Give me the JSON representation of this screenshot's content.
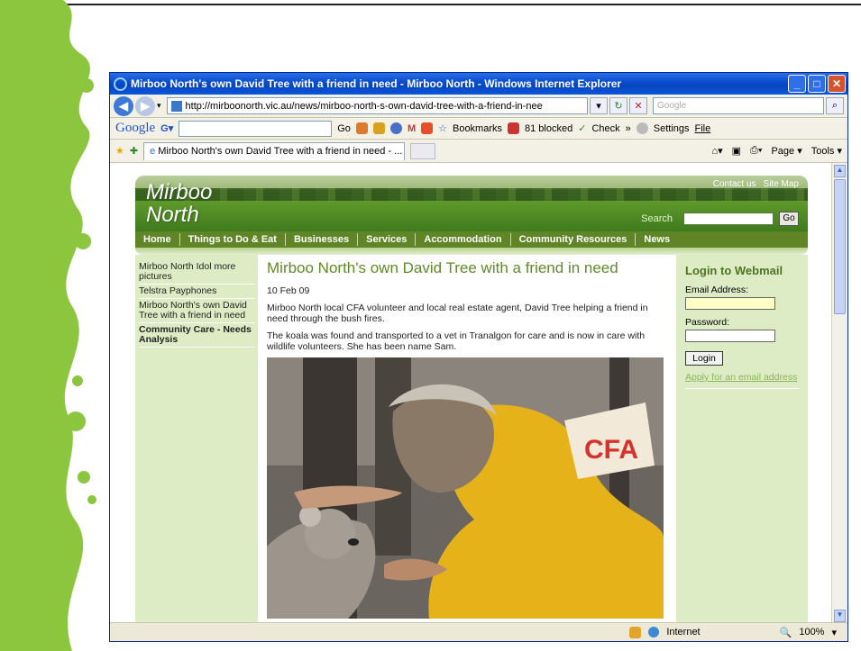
{
  "window": {
    "title": "Mirboo North's own David Tree with a friend in need - Mirboo North - Windows Internet Explorer",
    "url": "http://mirboonorth.vic.au/news/mirboo-north-s-own-david-tree-with-a-friend-in-nee",
    "search_placeholder": "Google"
  },
  "google_toolbar": {
    "logo": "Google",
    "go": "Go",
    "bookmarks": "Bookmarks",
    "blocked": "81 blocked",
    "check": "Check",
    "settings": "Settings",
    "file": "File"
  },
  "tabs": {
    "active": "Mirboo North's own David Tree with a friend in need - ...",
    "page": "Page",
    "tools": "Tools"
  },
  "site": {
    "name_line1": "Mirboo",
    "name_line2": "North",
    "contact": "Contact us",
    "sitemap": "Site Map",
    "search_label": "Search",
    "search_go": "Go",
    "nav": [
      "Home",
      "Things to Do & Eat",
      "Businesses",
      "Services",
      "Accommodation",
      "Community Resources",
      "News"
    ]
  },
  "sidebar": {
    "links": [
      {
        "label": "Mirboo North Idol more pictures"
      },
      {
        "label": "Telstra Payphones"
      },
      {
        "label": "Mirboo North's own David Tree with a friend in need"
      },
      {
        "label": "Community Care - Needs Analysis"
      }
    ]
  },
  "article": {
    "title": "Mirboo North's own David Tree with a friend in need",
    "date": "10 Feb 09",
    "p1": "Mirboo North local CFA volunteer and local real estate agent, David Tree helping a friend in need through the bush fires.",
    "p2": "The koala was found and transported to a vet in Tranalgon for care and is now in care with wildlife volunteers.  She has been name Sam.",
    "photo_text": "CFA"
  },
  "login": {
    "heading": "Login to Webmail",
    "email_label": "Email Address:",
    "password_label": "Password:",
    "button": "Login",
    "apply": "Apply for an email address"
  },
  "status": {
    "zone": "Internet",
    "zoom": "100%"
  },
  "colors": {
    "deco_green": "#8cc63f",
    "title_green": "#5f8a2a",
    "nav_green": "#5f8526",
    "sidebar_bg": "#ddecc4"
  }
}
